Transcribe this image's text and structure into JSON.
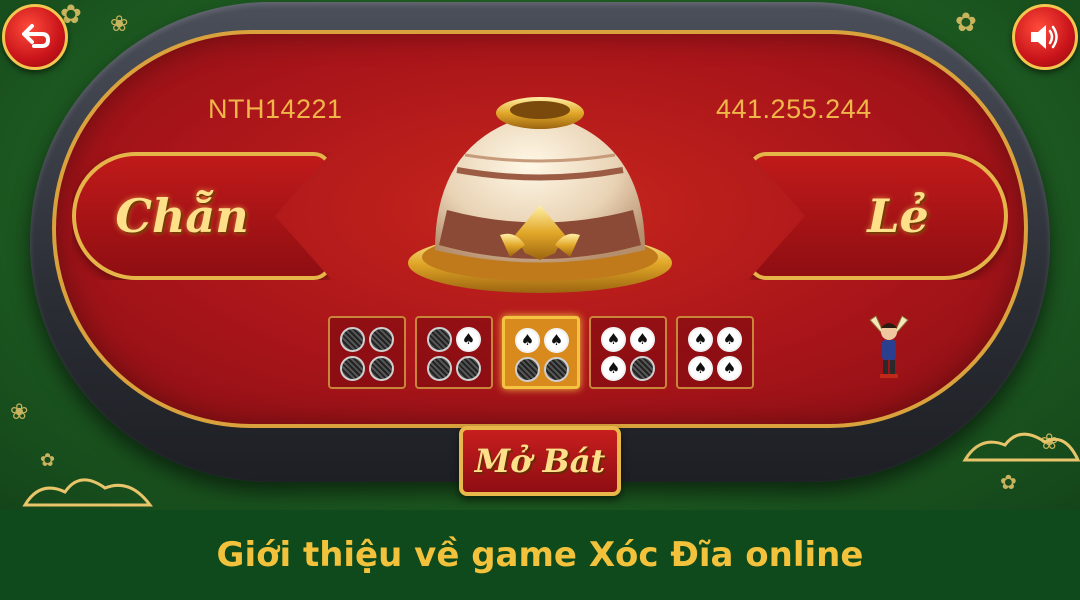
{
  "game": {
    "player_name": "NTH14221",
    "balance": "441.255.244",
    "bet_even_label": "Chẵn",
    "bet_odd_label": "Lẻ",
    "open_button_label": "Mở Bát"
  },
  "history": [
    {
      "coins": [
        "grey",
        "grey",
        "grey",
        "grey"
      ],
      "active": false
    },
    {
      "coins": [
        "grey",
        "white",
        "grey",
        "grey"
      ],
      "active": false
    },
    {
      "coins": [
        "white",
        "white",
        "grey",
        "grey"
      ],
      "active": true
    },
    {
      "coins": [
        "white",
        "white",
        "white",
        "grey"
      ],
      "active": false
    },
    {
      "coins": [
        "white",
        "white",
        "white",
        "white"
      ],
      "active": false
    }
  ],
  "coin_symbol": "♠",
  "icons": {
    "back": "back-arrow-icon",
    "sound": "speaker-icon"
  },
  "caption": "Giới thiệu về game Xóc Đĩa online",
  "colors": {
    "felt": "#b01a1a",
    "gold": "#e5b54a",
    "caption_bg": "#0e4a1c",
    "caption_text": "#f2c23c"
  }
}
